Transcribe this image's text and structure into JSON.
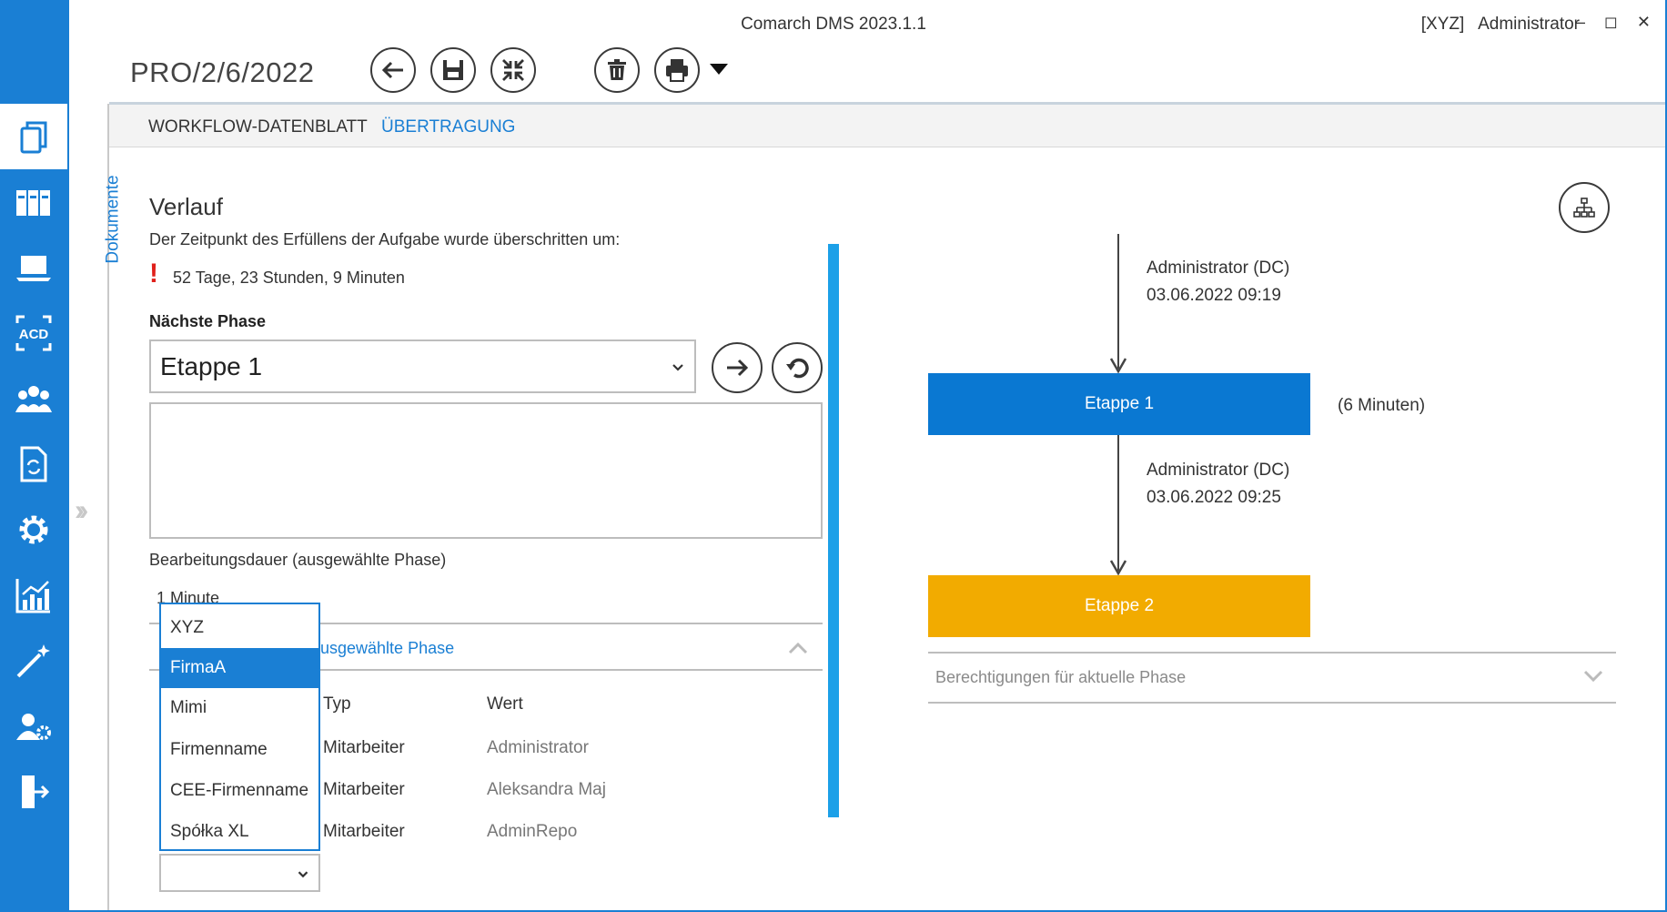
{
  "window": {
    "title": "Comarch DMS 2023.1.1",
    "company": "[XYZ]",
    "user": "Administrator",
    "controls": "– ◻ ✕"
  },
  "document": {
    "number": "PRO/2/6/2022"
  },
  "toolbar": {
    "icons": [
      "back-icon",
      "save-icon",
      "collapse-icon",
      "delete-icon",
      "print-icon"
    ]
  },
  "sidebar": {
    "vertical_tab": "Dokumente",
    "icons": [
      "documents-icon",
      "binders-icon",
      "laptop-icon",
      "acd-icon",
      "users-icon",
      "sync-document-icon",
      "gear-icon",
      "chart-icon",
      "magic-wand-icon",
      "user-settings-icon",
      "logout-icon"
    ],
    "acd_label": "ACD"
  },
  "tabs": [
    {
      "label": "WORKFLOW-DATENBLATT",
      "active": false
    },
    {
      "label": "ÜBERTRAGUNG",
      "active": true
    }
  ],
  "history": {
    "title": "Verlauf",
    "overdue_text": "Der Zeitpunkt des Erfüllens der Aufgabe wurde überschritten um:",
    "overdue_value": "52 Tage, 23 Stunden, 9 Minuten",
    "next_phase_label": "Nächste Phase",
    "next_phase_value": "Etappe 1",
    "duration_label": "Bearbeitungsdauer (ausgewählte Phase)",
    "duration_value": "1 Minute",
    "section_label": "usgewählte Phase"
  },
  "dropdown": {
    "options": [
      "XYZ",
      "FirmaA",
      "Mimi",
      "Firmenname",
      "CEE-Firmenname",
      "Spółka XL"
    ],
    "selected": "FirmaA"
  },
  "table": {
    "headers": [
      "Typ",
      "Wert"
    ],
    "rows": [
      {
        "typ": "Mitarbeiter",
        "wert": "Administrator"
      },
      {
        "typ": "Mitarbeiter",
        "wert": "Aleksandra Maj"
      },
      {
        "typ": "Mitarbeiter",
        "wert": "AdminRepo"
      }
    ]
  },
  "flow": {
    "step1": {
      "author": "Administrator (DC)",
      "date": "03.06.2022 09:19"
    },
    "phase1": {
      "label": "Etappe 1",
      "duration": "(6 Minuten)",
      "color": "#0a78d2"
    },
    "step2": {
      "author": "Administrator (DC)",
      "date": "03.06.2022 09:25"
    },
    "phase2": {
      "label": "Etappe 2",
      "color": "#f2ab00"
    },
    "permissions_label": "Berechtigungen für aktuelle Phase"
  },
  "colors": {
    "accent": "#1a7fd4",
    "scrollbar": "#1ca0e8",
    "overdue": "#e0201b"
  }
}
